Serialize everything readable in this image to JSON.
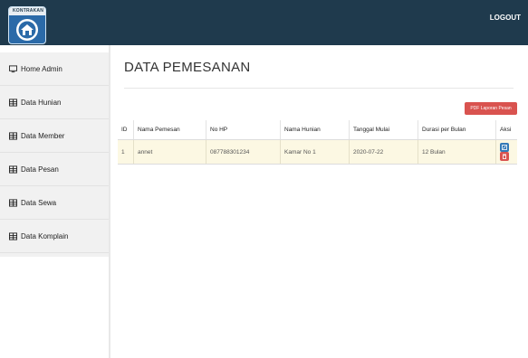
{
  "header": {
    "logo_text": "KONTRAKAN",
    "logout_label": "LOGOUT"
  },
  "sidebar": {
    "items": [
      {
        "label": "Home Admin",
        "icon": "monitor-icon"
      },
      {
        "label": "Data Hunian",
        "icon": "table-icon"
      },
      {
        "label": "Data Member",
        "icon": "table-icon"
      },
      {
        "label": "Data Pesan",
        "icon": "table-icon"
      },
      {
        "label": "Data Sewa",
        "icon": "table-icon"
      },
      {
        "label": "Data Komplain",
        "icon": "table-icon"
      }
    ]
  },
  "main": {
    "title": "DATA PEMESANAN",
    "pdf_button_label": "PDF Laporan Pesan",
    "table": {
      "columns": [
        "ID",
        "Nama Pemesan",
        "No HP",
        "Nama Hunian",
        "Tanggal Mulai",
        "Durasi per Bulan",
        "Aksi"
      ],
      "rows": [
        {
          "id": "1",
          "nama": "annet",
          "hp": "087788301234",
          "hunian": "Kamar No 1",
          "tanggal": "2020-07-22",
          "durasi": "12 Bulan"
        }
      ]
    }
  },
  "colors": {
    "topbar": "#1f3a4d",
    "danger": "#d9534f",
    "primary": "#337ab7",
    "row_highlight": "#fcf8e3"
  }
}
